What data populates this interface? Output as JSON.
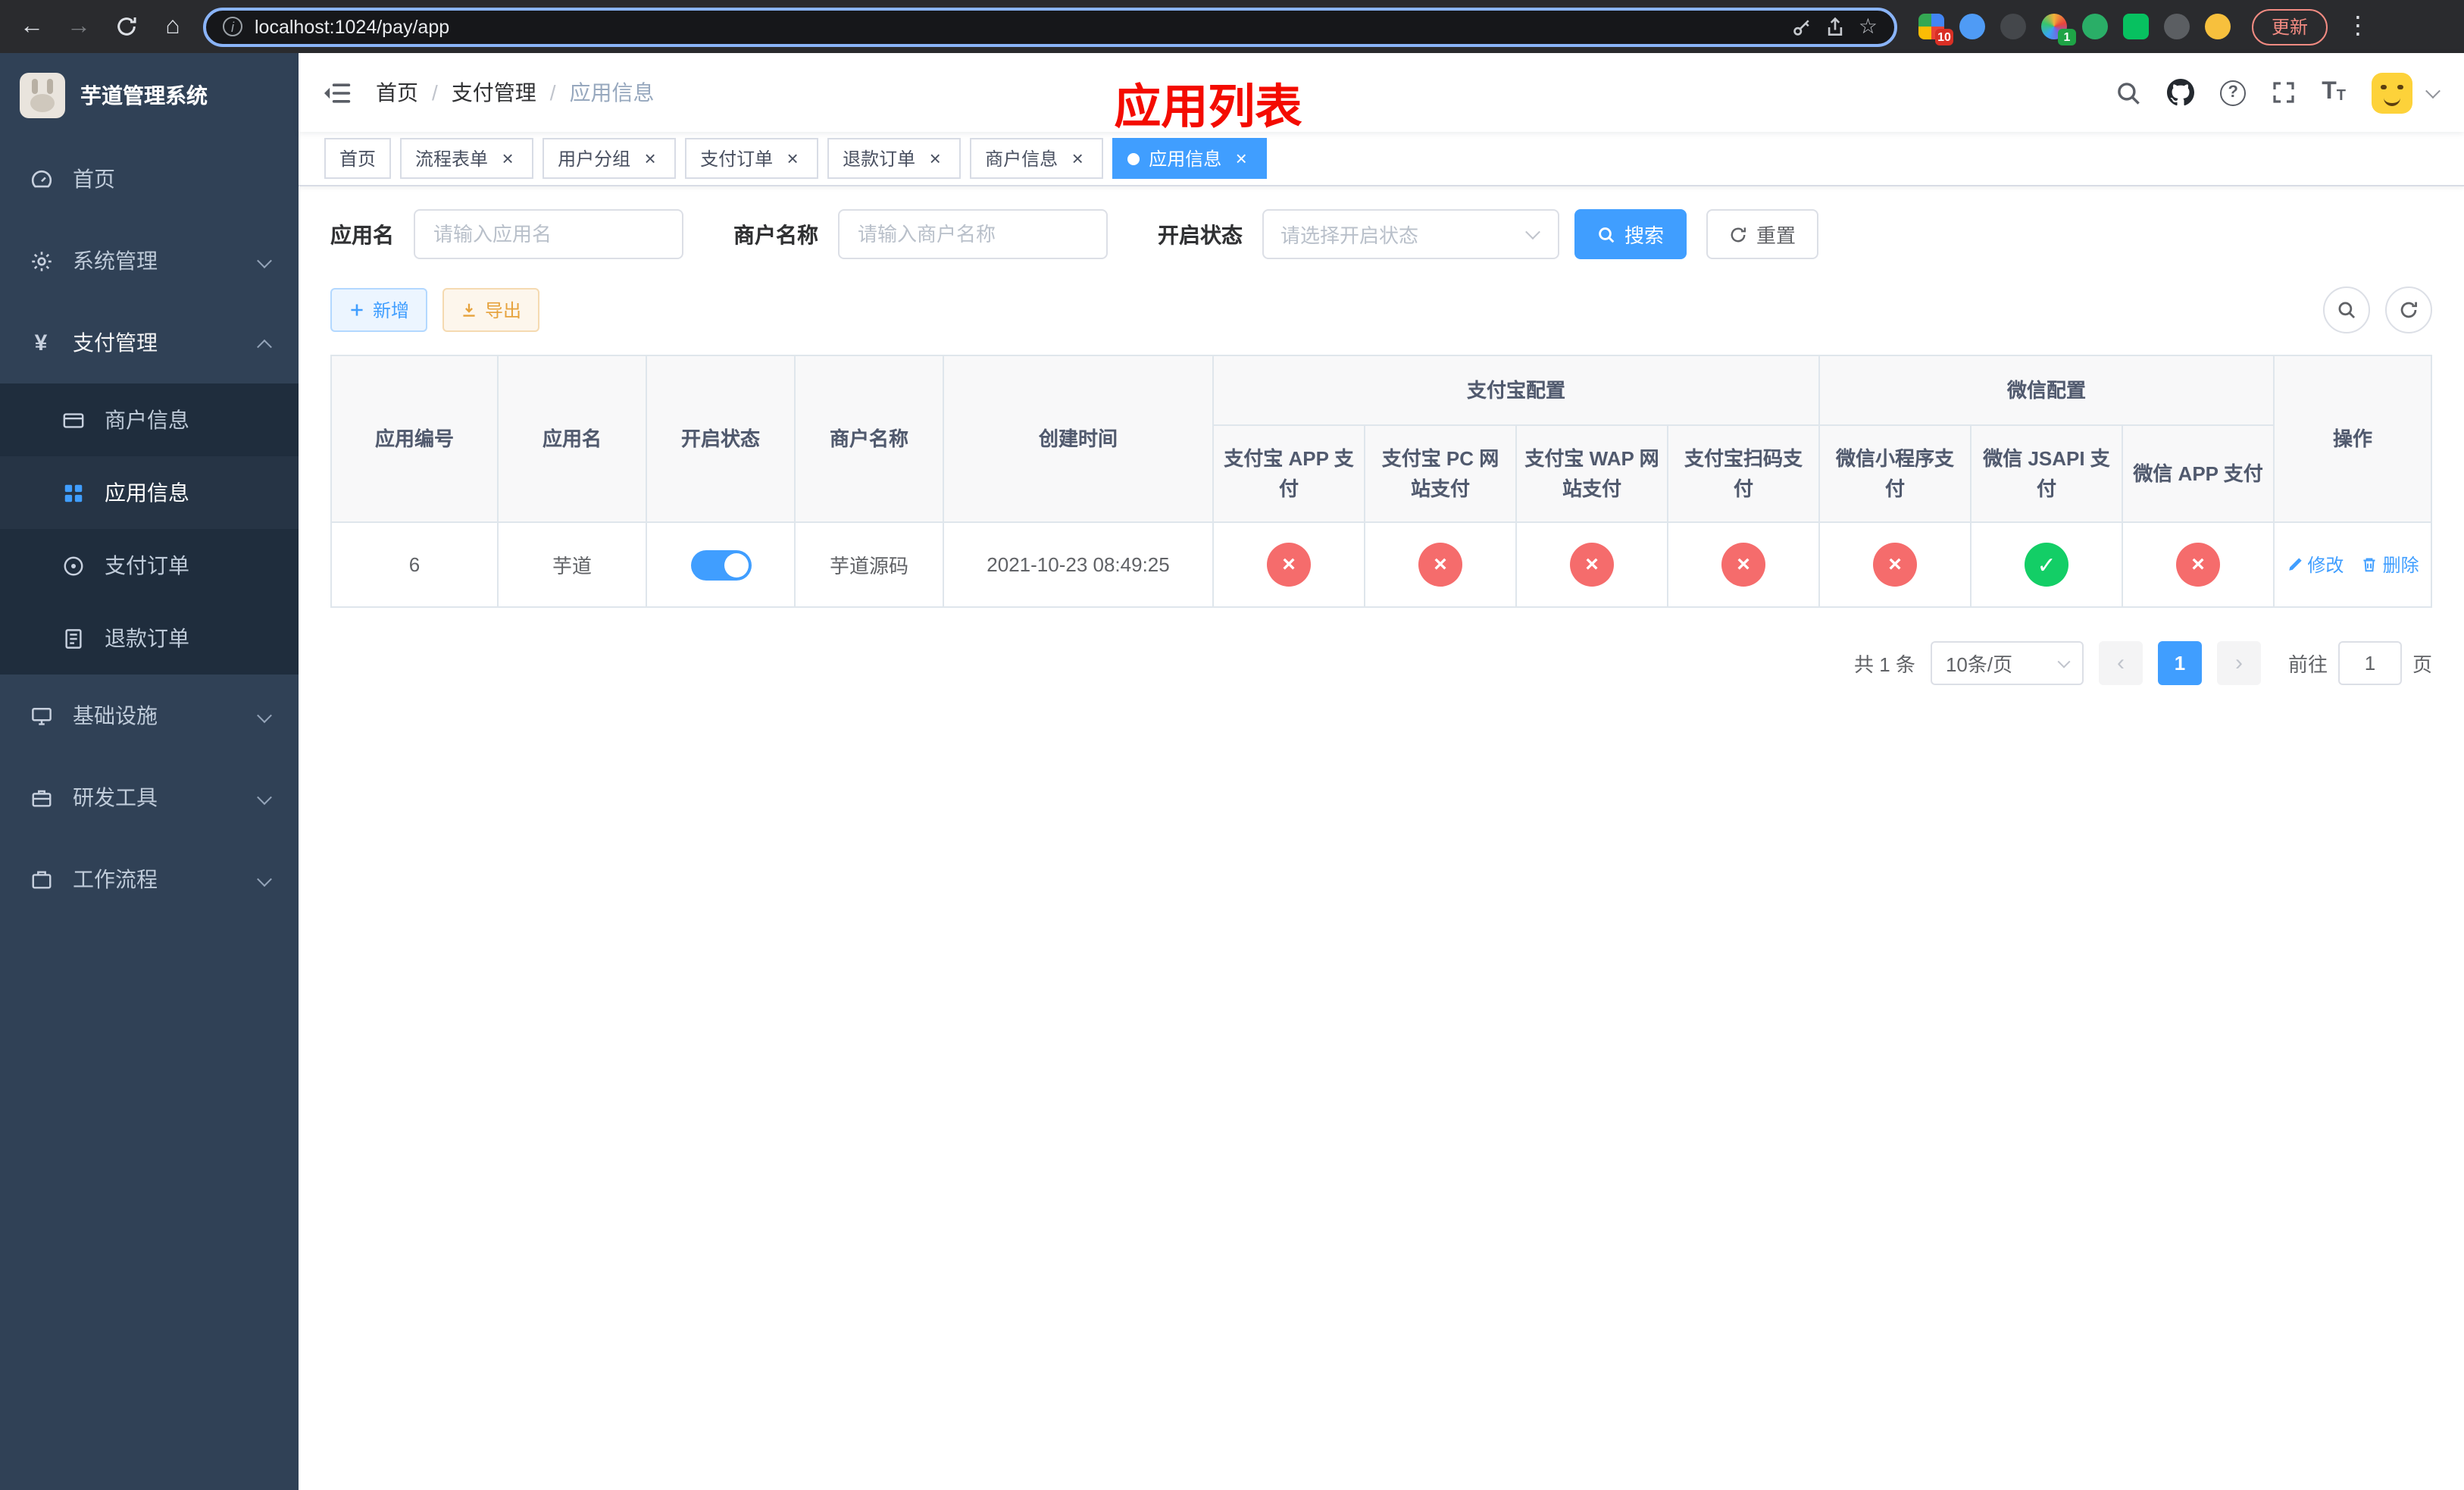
{
  "browser": {
    "url": "localhost:1024/pay/app",
    "update_label": "更新",
    "ext_badge_grid": "10",
    "ext_badge_colorful": "1"
  },
  "sidebar": {
    "logo_title": "芋道管理系统",
    "items": {
      "home": "首页",
      "system": "系统管理",
      "payment": "支付管理",
      "infra": "基础设施",
      "devtools": "研发工具",
      "workflow": "工作流程"
    },
    "payment_children": {
      "merchant": "商户信息",
      "app": "应用信息",
      "order": "支付订单",
      "refund": "退款订单"
    }
  },
  "header": {
    "breadcrumb": [
      "首页",
      "支付管理",
      "应用信息"
    ],
    "overlay_title": "应用列表"
  },
  "tabs": [
    {
      "label": "首页"
    },
    {
      "label": "流程表单"
    },
    {
      "label": "用户分组"
    },
    {
      "label": "支付订单"
    },
    {
      "label": "退款订单"
    },
    {
      "label": "商户信息"
    },
    {
      "label": "应用信息"
    }
  ],
  "filters": {
    "app_name_label": "应用名",
    "app_name_placeholder": "请输入应用名",
    "merchant_label": "商户名称",
    "merchant_placeholder": "请输入商户名称",
    "status_label": "开启状态",
    "status_placeholder": "请选择开启状态",
    "search_label": "搜索",
    "reset_label": "重置"
  },
  "toolbar": {
    "add_label": "新增",
    "export_label": "导出"
  },
  "table": {
    "columns": {
      "id": "应用编号",
      "name": "应用名",
      "status": "开启状态",
      "merchant": "商户名称",
      "created": "创建时间",
      "alipay_group": "支付宝配置",
      "wechat_group": "微信配置",
      "alipay_app": "支付宝 APP 支付",
      "alipay_pc": "支付宝 PC 网站支付",
      "alipay_wap": "支付宝 WAP 网站支付",
      "alipay_qr": "支付宝扫码支付",
      "wx_lite": "微信小程序支付",
      "wx_jsapi": "微信 JSAPI 支付",
      "wx_app": "微信 APP 支付",
      "actions": "操作"
    },
    "rows": [
      {
        "id": "6",
        "name": "芋道",
        "enabled": true,
        "merchant": "芋道源码",
        "created": "2021-10-23 08:49:25",
        "configs": {
          "alipay_app": false,
          "alipay_pc": false,
          "alipay_wap": false,
          "alipay_qr": false,
          "wx_lite": false,
          "wx_jsapi": true,
          "wx_app": false
        },
        "edit_label": "修改",
        "delete_label": "删除"
      }
    ]
  },
  "pagination": {
    "total_text": "共 1 条",
    "page_size_text": "10条/页",
    "current_page": "1",
    "goto_label": "前往",
    "goto_value": "1",
    "goto_unit": "页"
  },
  "colors": {
    "accent": "#409eff",
    "danger": "#f56c6c",
    "success": "#13ce66",
    "sidebar_bg": "#304156"
  }
}
